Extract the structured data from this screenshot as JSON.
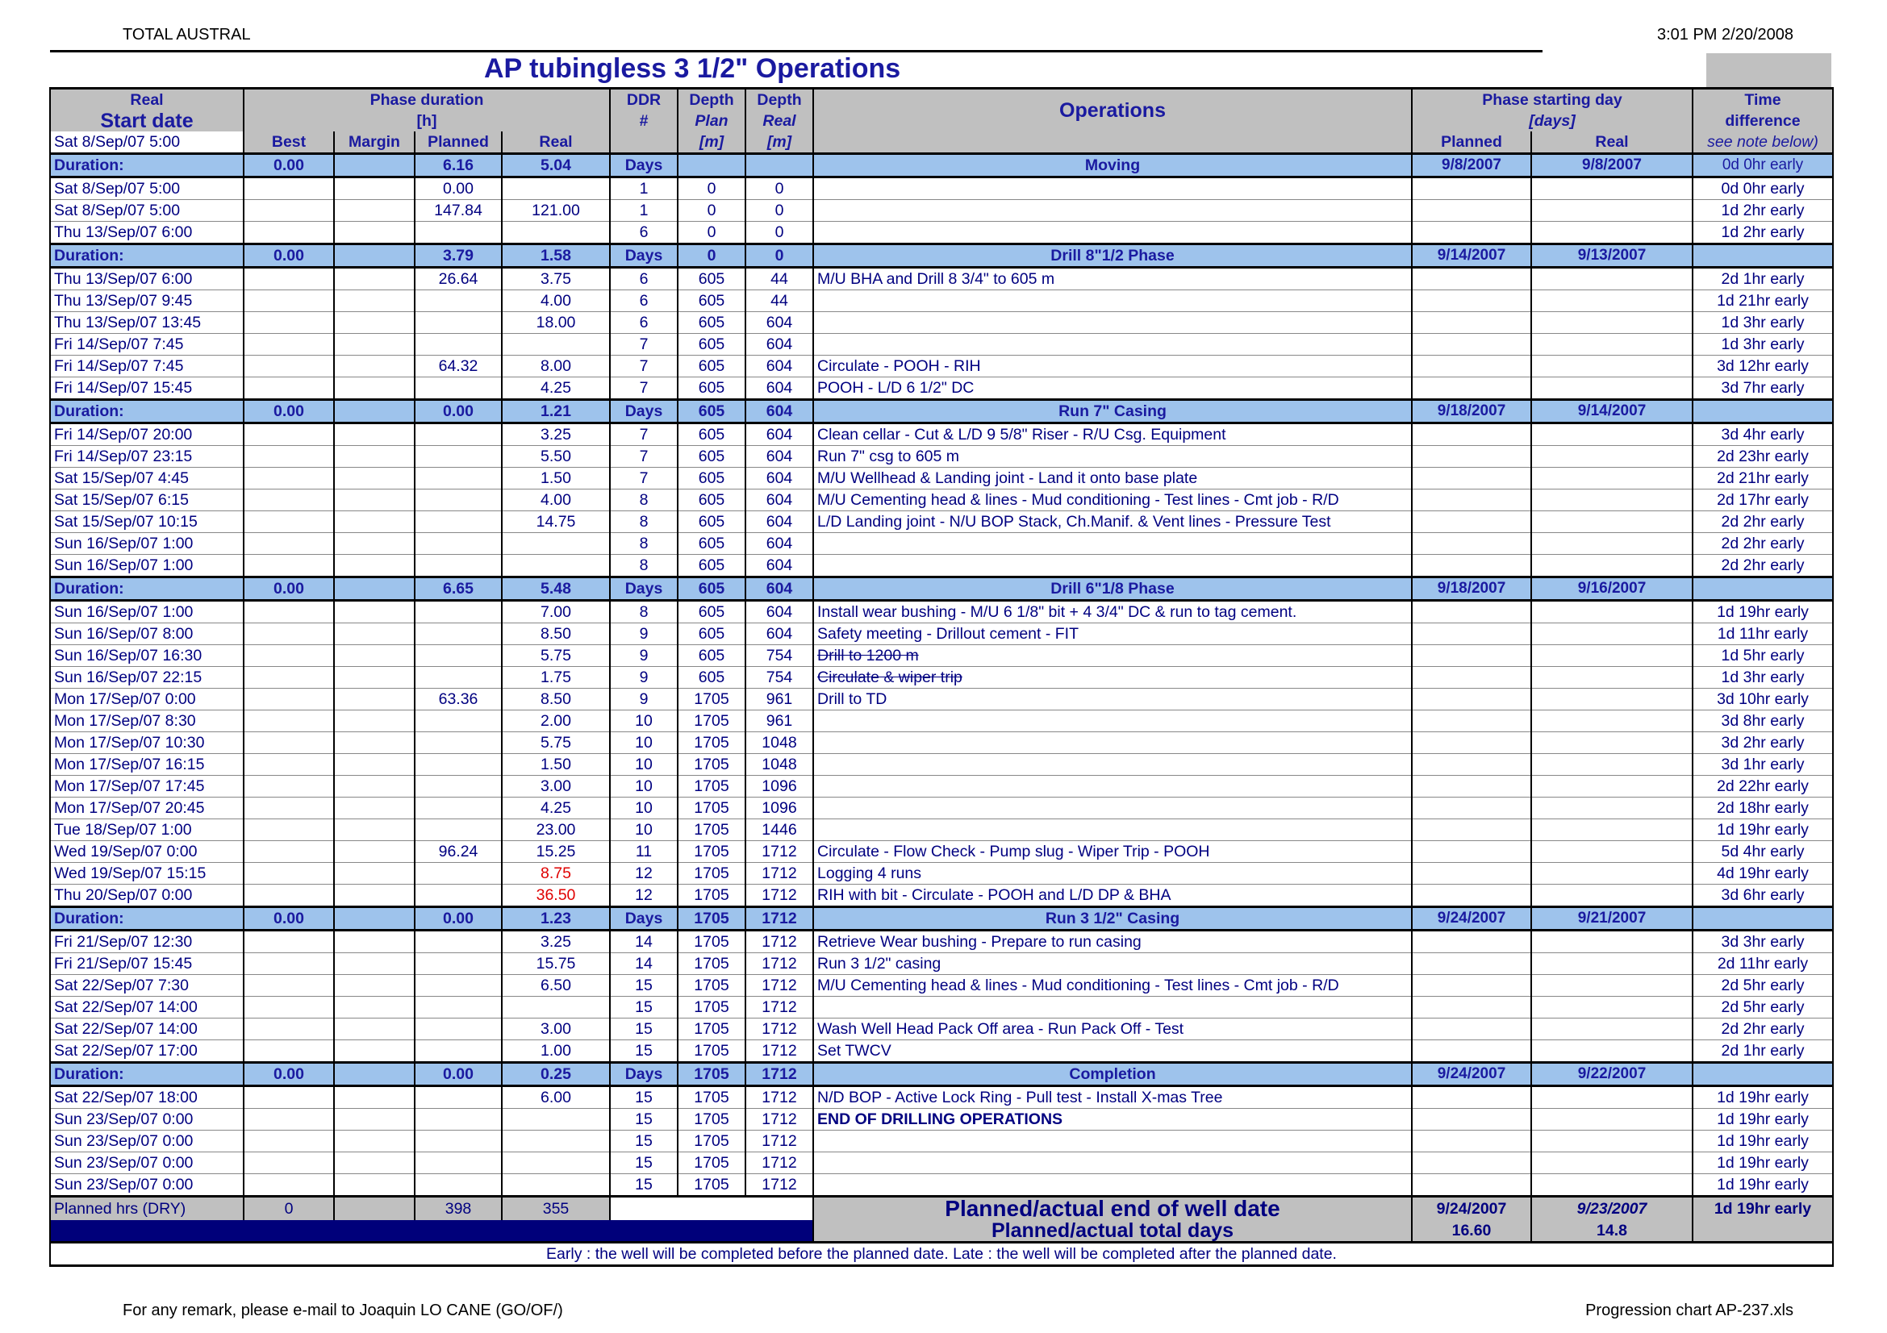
{
  "header": {
    "company": "TOTAL AUSTRAL",
    "timestamp": "3:01 PM 2/20/2008",
    "title": "AP tubingless 3 1/2\" Operations"
  },
  "columns": {
    "real": "Real",
    "start_date": "Start date",
    "start_value": "Sat 8/Sep/07 5:00",
    "phase_duration": "Phase duration",
    "hours": "[h]",
    "best": "Best",
    "margin": "Margin",
    "planned": "Planned",
    "real_h": "Real",
    "ddr": "DDR",
    "hash": "#",
    "depth": "Depth",
    "plan": "Plan",
    "depth_real": "Real",
    "m": "[m]",
    "operations": "Operations",
    "phase_start": "Phase starting day",
    "days": "[days]",
    "ps_planned": "Planned",
    "ps_real": "Real",
    "time": "Time",
    "difference": "difference",
    "note": "see note below)"
  },
  "phases": [
    {
      "label": "Duration:",
      "best": "0.00",
      "planned": "6.16",
      "real": "5.04",
      "unit": "Days",
      "plan": "",
      "real_depth": "",
      "name": "Moving",
      "ps_planned": "9/8/2007",
      "ps_real": "9/8/2007",
      "diff": "0d 0hr early",
      "rows": [
        {
          "date": "Sat 8/Sep/07 5:00",
          "best": "",
          "margin": "",
          "planned": "0.00",
          "real": "",
          "ddr": "1",
          "plan": "0",
          "depth_real": "0",
          "op": "",
          "diff": "0d 0hr early"
        },
        {
          "date": "Sat 8/Sep/07 5:00",
          "best": "",
          "margin": "",
          "planned": "147.84",
          "real": "121.00",
          "ddr": "1",
          "plan": "0",
          "depth_real": "0",
          "op": "",
          "diff": "1d 2hr early"
        },
        {
          "date": "Thu 13/Sep/07 6:00",
          "best": "",
          "margin": "",
          "planned": "",
          "real": "",
          "ddr": "6",
          "plan": "0",
          "depth_real": "0",
          "op": "",
          "diff": "1d 2hr early"
        }
      ]
    },
    {
      "label": "Duration:",
      "best": "0.00",
      "planned": "3.79",
      "real": "1.58",
      "unit": "Days",
      "plan": "0",
      "real_depth": "0",
      "name": "Drill 8\"1/2 Phase",
      "ps_planned": "9/14/2007",
      "ps_real": "9/13/2007",
      "diff": "",
      "rows": [
        {
          "date": "Thu 13/Sep/07 6:00",
          "best": "",
          "margin": "",
          "planned": "26.64",
          "real": "3.75",
          "ddr": "6",
          "plan": "605",
          "depth_real": "44",
          "op": "M/U BHA and Drill 8 3/4\" to 605 m",
          "diff": "2d 1hr early"
        },
        {
          "date": "Thu 13/Sep/07 9:45",
          "best": "",
          "margin": "",
          "planned": "",
          "real": "4.00",
          "ddr": "6",
          "plan": "605",
          "depth_real": "44",
          "op": "",
          "diff": "1d 21hr early"
        },
        {
          "date": "Thu 13/Sep/07 13:45",
          "best": "",
          "margin": "",
          "planned": "",
          "real": "18.00",
          "ddr": "6",
          "plan": "605",
          "depth_real": "604",
          "op": "",
          "diff": "1d 3hr early"
        },
        {
          "date": "Fri 14/Sep/07 7:45",
          "best": "",
          "margin": "",
          "planned": "",
          "real": "",
          "ddr": "7",
          "plan": "605",
          "depth_real": "604",
          "op": "",
          "diff": "1d 3hr early"
        },
        {
          "date": "Fri 14/Sep/07 7:45",
          "best": "",
          "margin": "",
          "planned": "64.32",
          "real": "8.00",
          "ddr": "7",
          "plan": "605",
          "depth_real": "604",
          "op": "Circulate - POOH - RIH",
          "diff": "3d 12hr early"
        },
        {
          "date": "Fri 14/Sep/07 15:45",
          "best": "",
          "margin": "",
          "planned": "",
          "real": "4.25",
          "ddr": "7",
          "plan": "605",
          "depth_real": "604",
          "op": "POOH - L/D 6 1/2\" DC",
          "diff": "3d 7hr early"
        }
      ]
    },
    {
      "label": "Duration:",
      "best": "0.00",
      "planned": "0.00",
      "real": "1.21",
      "unit": "Days",
      "plan": "605",
      "real_depth": "604",
      "name": "Run 7\" Casing",
      "ps_planned": "9/18/2007",
      "ps_real": "9/14/2007",
      "diff": "",
      "rows": [
        {
          "date": "Fri 14/Sep/07 20:00",
          "best": "",
          "margin": "",
          "planned": "",
          "real": "3.25",
          "ddr": "7",
          "plan": "605",
          "depth_real": "604",
          "op": "Clean cellar - Cut & L/D 9 5/8\" Riser - R/U Csg. Equipment",
          "diff": "3d 4hr early"
        },
        {
          "date": "Fri 14/Sep/07 23:15",
          "best": "",
          "margin": "",
          "planned": "",
          "real": "5.50",
          "ddr": "7",
          "plan": "605",
          "depth_real": "604",
          "op": "Run 7\" csg to 605 m",
          "diff": "2d 23hr early"
        },
        {
          "date": "Sat 15/Sep/07 4:45",
          "best": "",
          "margin": "",
          "planned": "",
          "real": "1.50",
          "ddr": "7",
          "plan": "605",
          "depth_real": "604",
          "op": "M/U Wellhead & Landing joint - Land it onto base plate",
          "diff": "2d 21hr early"
        },
        {
          "date": "Sat 15/Sep/07 6:15",
          "best": "",
          "margin": "",
          "planned": "",
          "real": "4.00",
          "ddr": "8",
          "plan": "605",
          "depth_real": "604",
          "op": "M/U Cementing head & lines - Mud conditioning - Test lines - Cmt job - R/D",
          "diff": "2d 17hr early"
        },
        {
          "date": "Sat 15/Sep/07 10:15",
          "best": "",
          "margin": "",
          "planned": "",
          "real": "14.75",
          "ddr": "8",
          "plan": "605",
          "depth_real": "604",
          "op": "L/D Landing joint - N/U BOP Stack, Ch.Manif. & Vent lines - Pressure Test",
          "diff": "2d 2hr early"
        },
        {
          "date": "Sun 16/Sep/07 1:00",
          "best": "",
          "margin": "",
          "planned": "",
          "real": "",
          "ddr": "8",
          "plan": "605",
          "depth_real": "604",
          "op": "",
          "diff": "2d 2hr early"
        },
        {
          "date": "Sun 16/Sep/07 1:00",
          "best": "",
          "margin": "",
          "planned": "",
          "real": "",
          "ddr": "8",
          "plan": "605",
          "depth_real": "604",
          "op": "",
          "diff": "2d 2hr early"
        }
      ]
    },
    {
      "label": "Duration:",
      "best": "0.00",
      "planned": "6.65",
      "real": "5.48",
      "unit": "Days",
      "plan": "605",
      "real_depth": "604",
      "name": "Drill 6\"1/8 Phase",
      "ps_planned": "9/18/2007",
      "ps_real": "9/16/2007",
      "diff": "",
      "rows": [
        {
          "date": "Sun 16/Sep/07 1:00",
          "best": "",
          "margin": "",
          "planned": "",
          "real": "7.00",
          "ddr": "8",
          "plan": "605",
          "depth_real": "604",
          "op": "Install wear bushing - M/U 6 1/8\" bit + 4 3/4\" DC & run to tag cement.",
          "diff": "1d 19hr early"
        },
        {
          "date": "Sun 16/Sep/07 8:00",
          "best": "",
          "margin": "",
          "planned": "",
          "real": "8.50",
          "ddr": "9",
          "plan": "605",
          "depth_real": "604",
          "op": "Safety meeting - Drillout cement - FIT",
          "diff": "1d 11hr early"
        },
        {
          "date": "Sun 16/Sep/07 16:30",
          "best": "",
          "margin": "",
          "planned": "",
          "real": "5.75",
          "ddr": "9",
          "plan": "605",
          "depth_real": "754",
          "op": "Drill to 1200 m",
          "strike": true,
          "diff": "1d 5hr early"
        },
        {
          "date": "Sun 16/Sep/07 22:15",
          "best": "",
          "margin": "",
          "planned": "",
          "real": "1.75",
          "ddr": "9",
          "plan": "605",
          "depth_real": "754",
          "op": "Circulate & wiper trip",
          "strike": true,
          "diff": "1d 3hr early"
        },
        {
          "date": "Mon 17/Sep/07 0:00",
          "best": "",
          "margin": "",
          "planned": "63.36",
          "real": "8.50",
          "ddr": "9",
          "plan": "1705",
          "depth_real": "961",
          "op": "Drill to TD",
          "diff": "3d 10hr early"
        },
        {
          "date": "Mon 17/Sep/07 8:30",
          "best": "",
          "margin": "",
          "planned": "",
          "real": "2.00",
          "ddr": "10",
          "plan": "1705",
          "depth_real": "961",
          "op": "",
          "diff": "3d 8hr early"
        },
        {
          "date": "Mon 17/Sep/07 10:30",
          "best": "",
          "margin": "",
          "planned": "",
          "real": "5.75",
          "ddr": "10",
          "plan": "1705",
          "depth_real": "1048",
          "op": "",
          "diff": "3d 2hr early"
        },
        {
          "date": "Mon 17/Sep/07 16:15",
          "best": "",
          "margin": "",
          "planned": "",
          "real": "1.50",
          "ddr": "10",
          "plan": "1705",
          "depth_real": "1048",
          "op": "",
          "diff": "3d 1hr early"
        },
        {
          "date": "Mon 17/Sep/07 17:45",
          "best": "",
          "margin": "",
          "planned": "",
          "real": "3.00",
          "ddr": "10",
          "plan": "1705",
          "depth_real": "1096",
          "op": "",
          "diff": "2d 22hr early"
        },
        {
          "date": "Mon 17/Sep/07 20:45",
          "best": "",
          "margin": "",
          "planned": "",
          "real": "4.25",
          "ddr": "10",
          "plan": "1705",
          "depth_real": "1096",
          "op": "",
          "diff": "2d 18hr early"
        },
        {
          "date": "Tue 18/Sep/07 1:00",
          "best": "",
          "margin": "",
          "planned": "",
          "real": "23.00",
          "ddr": "10",
          "plan": "1705",
          "depth_real": "1446",
          "op": "",
          "diff": "1d 19hr early"
        },
        {
          "date": "Wed 19/Sep/07 0:00",
          "best": "",
          "margin": "",
          "planned": "96.24",
          "real": "15.25",
          "ddr": "11",
          "plan": "1705",
          "depth_real": "1712",
          "op": "Circulate - Flow Check - Pump slug - Wiper Trip - POOH",
          "diff": "5d 4hr early"
        },
        {
          "date": "Wed 19/Sep/07 15:15",
          "best": "",
          "margin": "",
          "planned": "",
          "real": "8.75",
          "red": true,
          "ddr": "12",
          "plan": "1705",
          "depth_real": "1712",
          "op": "Logging 4 runs",
          "diff": "4d 19hr early"
        },
        {
          "date": "Thu 20/Sep/07 0:00",
          "best": "",
          "margin": "",
          "planned": "",
          "real": "36.50",
          "red": true,
          "ddr": "12",
          "plan": "1705",
          "depth_real": "1712",
          "op": "RIH with bit - Circulate - POOH and L/D DP & BHA",
          "diff": "3d 6hr early"
        }
      ]
    },
    {
      "label": "Duration:",
      "best": "0.00",
      "planned": "0.00",
      "real": "1.23",
      "unit": "Days",
      "plan": "1705",
      "real_depth": "1712",
      "name": "Run 3 1/2\" Casing",
      "ps_planned": "9/24/2007",
      "ps_real": "9/21/2007",
      "diff": "",
      "rows": [
        {
          "date": "Fri 21/Sep/07 12:30",
          "best": "",
          "margin": "",
          "planned": "",
          "real": "3.25",
          "ddr": "14",
          "plan": "1705",
          "depth_real": "1712",
          "op": "Retrieve Wear bushing - Prepare to run casing",
          "diff": "3d 3hr early"
        },
        {
          "date": "Fri 21/Sep/07 15:45",
          "best": "",
          "margin": "",
          "planned": "",
          "real": "15.75",
          "ddr": "14",
          "plan": "1705",
          "depth_real": "1712",
          "op": "Run 3 1/2\" casing",
          "diff": "2d 11hr early"
        },
        {
          "date": "Sat 22/Sep/07 7:30",
          "best": "",
          "margin": "",
          "planned": "",
          "real": "6.50",
          "ddr": "15",
          "plan": "1705",
          "depth_real": "1712",
          "op": "M/U Cementing head & lines - Mud conditioning - Test lines - Cmt job - R/D",
          "diff": "2d 5hr early"
        },
        {
          "date": "Sat 22/Sep/07 14:00",
          "best": "",
          "margin": "",
          "planned": "",
          "real": "",
          "ddr": "15",
          "plan": "1705",
          "depth_real": "1712",
          "op": "",
          "diff": "2d 5hr early"
        },
        {
          "date": "Sat 22/Sep/07 14:00",
          "best": "",
          "margin": "",
          "planned": "",
          "real": "3.00",
          "ddr": "15",
          "plan": "1705",
          "depth_real": "1712",
          "op": "Wash Well Head Pack Off area - Run Pack Off - Test",
          "diff": "2d 2hr early"
        },
        {
          "date": "Sat 22/Sep/07 17:00",
          "best": "",
          "margin": "",
          "planned": "",
          "real": "1.00",
          "ddr": "15",
          "plan": "1705",
          "depth_real": "1712",
          "op": "Set TWCV",
          "diff": "2d 1hr early"
        }
      ]
    },
    {
      "label": "Duration:",
      "best": "0.00",
      "planned": "0.00",
      "real": "0.25",
      "unit": "Days",
      "plan": "1705",
      "real_depth": "1712",
      "name": "Completion",
      "ps_planned": "9/24/2007",
      "ps_real": "9/22/2007",
      "diff": "",
      "rows": [
        {
          "date": "Sat 22/Sep/07 18:00",
          "best": "",
          "margin": "",
          "planned": "",
          "real": "6.00",
          "ddr": "15",
          "plan": "1705",
          "depth_real": "1712",
          "op": "N/D BOP - Active Lock Ring - Pull test - Install X-mas Tree",
          "diff": "1d 19hr early"
        },
        {
          "date": "Sun 23/Sep/07 0:00",
          "best": "",
          "margin": "",
          "planned": "",
          "real": "",
          "ddr": "15",
          "plan": "1705",
          "depth_real": "1712",
          "op": "END OF DRILLING OPERATIONS",
          "bold": true,
          "diff": "1d 19hr early"
        },
        {
          "date": "Sun 23/Sep/07 0:00",
          "best": "",
          "margin": "",
          "planned": "",
          "real": "",
          "ddr": "15",
          "plan": "1705",
          "depth_real": "1712",
          "op": "",
          "diff": "1d 19hr early"
        },
        {
          "date": "Sun 23/Sep/07 0:00",
          "best": "",
          "margin": "",
          "planned": "",
          "real": "",
          "ddr": "15",
          "plan": "1705",
          "depth_real": "1712",
          "op": "",
          "diff": "1d 19hr early"
        },
        {
          "date": "Sun 23/Sep/07 0:00",
          "best": "",
          "margin": "",
          "planned": "",
          "real": "",
          "ddr": "15",
          "plan": "1705",
          "depth_real": "1712",
          "op": "",
          "diff": "1d 19hr early"
        }
      ]
    }
  ],
  "summary": {
    "label": "Planned hrs (DRY)",
    "best": "0",
    "planned": "398",
    "real": "355",
    "end_date_label": "Planned/actual end of well date",
    "end_planned": "9/24/2007",
    "end_real": "9/23/2007",
    "end_diff": "1d 19hr early",
    "total_days_label": "Planned/actual total days",
    "total_planned": "16.60",
    "total_real": "14.8"
  },
  "note": "Early : the well will be completed before the planned date. Late : the well will be completed after the planned date.",
  "footer": {
    "left": "For any remark, please e-mail to Joaquin LO CANE (GO/OF/)",
    "right": "Progression chart AP-237.xls"
  }
}
